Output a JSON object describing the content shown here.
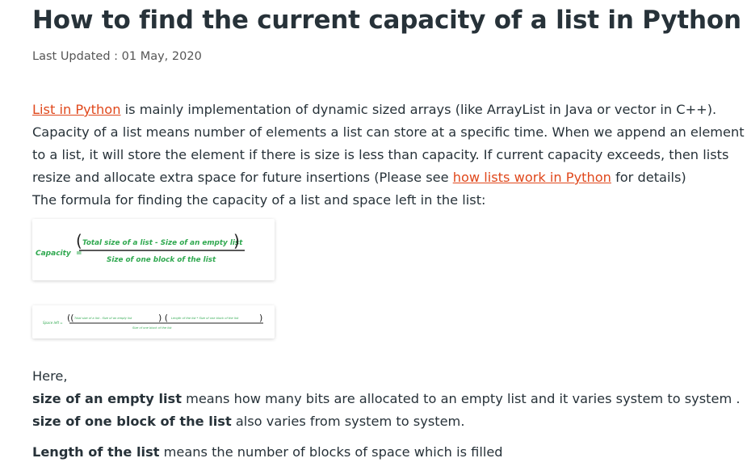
{
  "article": {
    "title": "How to find the current capacity of a list in Python",
    "last_updated": "Last Updated : 01 May, 2020",
    "intro": {
      "link1": "List in Python",
      "line1_rest": " is mainly implementation of dynamic sized arrays (like ArrayList in Java or vector in C++).",
      "line2": "Capacity of a list means number of elements a list can store at a specific time. When we append an element",
      "line3": "to a list, it will store the element if there is size is less than capacity. If current capacity exceeds, then lists",
      "line4_pre": "resize and allocate extra space for future insertions (Please see ",
      "link2": "how lists work in Python",
      "line4_post": " for details)",
      "line5": "The formula for finding the capacity of a list and space left in the list:"
    },
    "formula1": {
      "lhs": "Capacity  =",
      "numerator": "Total size of a list - Size of an empty list",
      "denominator": "Size of one block of the list"
    },
    "formula2": {
      "lhs": "Space left =",
      "numerator_a": "Total size of a list - Size of an empty list",
      "numerator_b": "Length of the list * Size of one block of the list",
      "denominator": "Size of one block of the list"
    },
    "here": "Here,",
    "def1_term": "size of an empty list",
    "def1_text": " means how many bits are allocated to an empty list and it varies system to system .",
    "def2_term": "size of one block of the list",
    "def2_text": " also varies from system to system.",
    "def3_term": "Length of the list",
    "def3_text": " means the number of blocks of space which is filled"
  },
  "colors": {
    "link": "#e0481c",
    "formula": "#2fa84f",
    "text": "#273239"
  }
}
